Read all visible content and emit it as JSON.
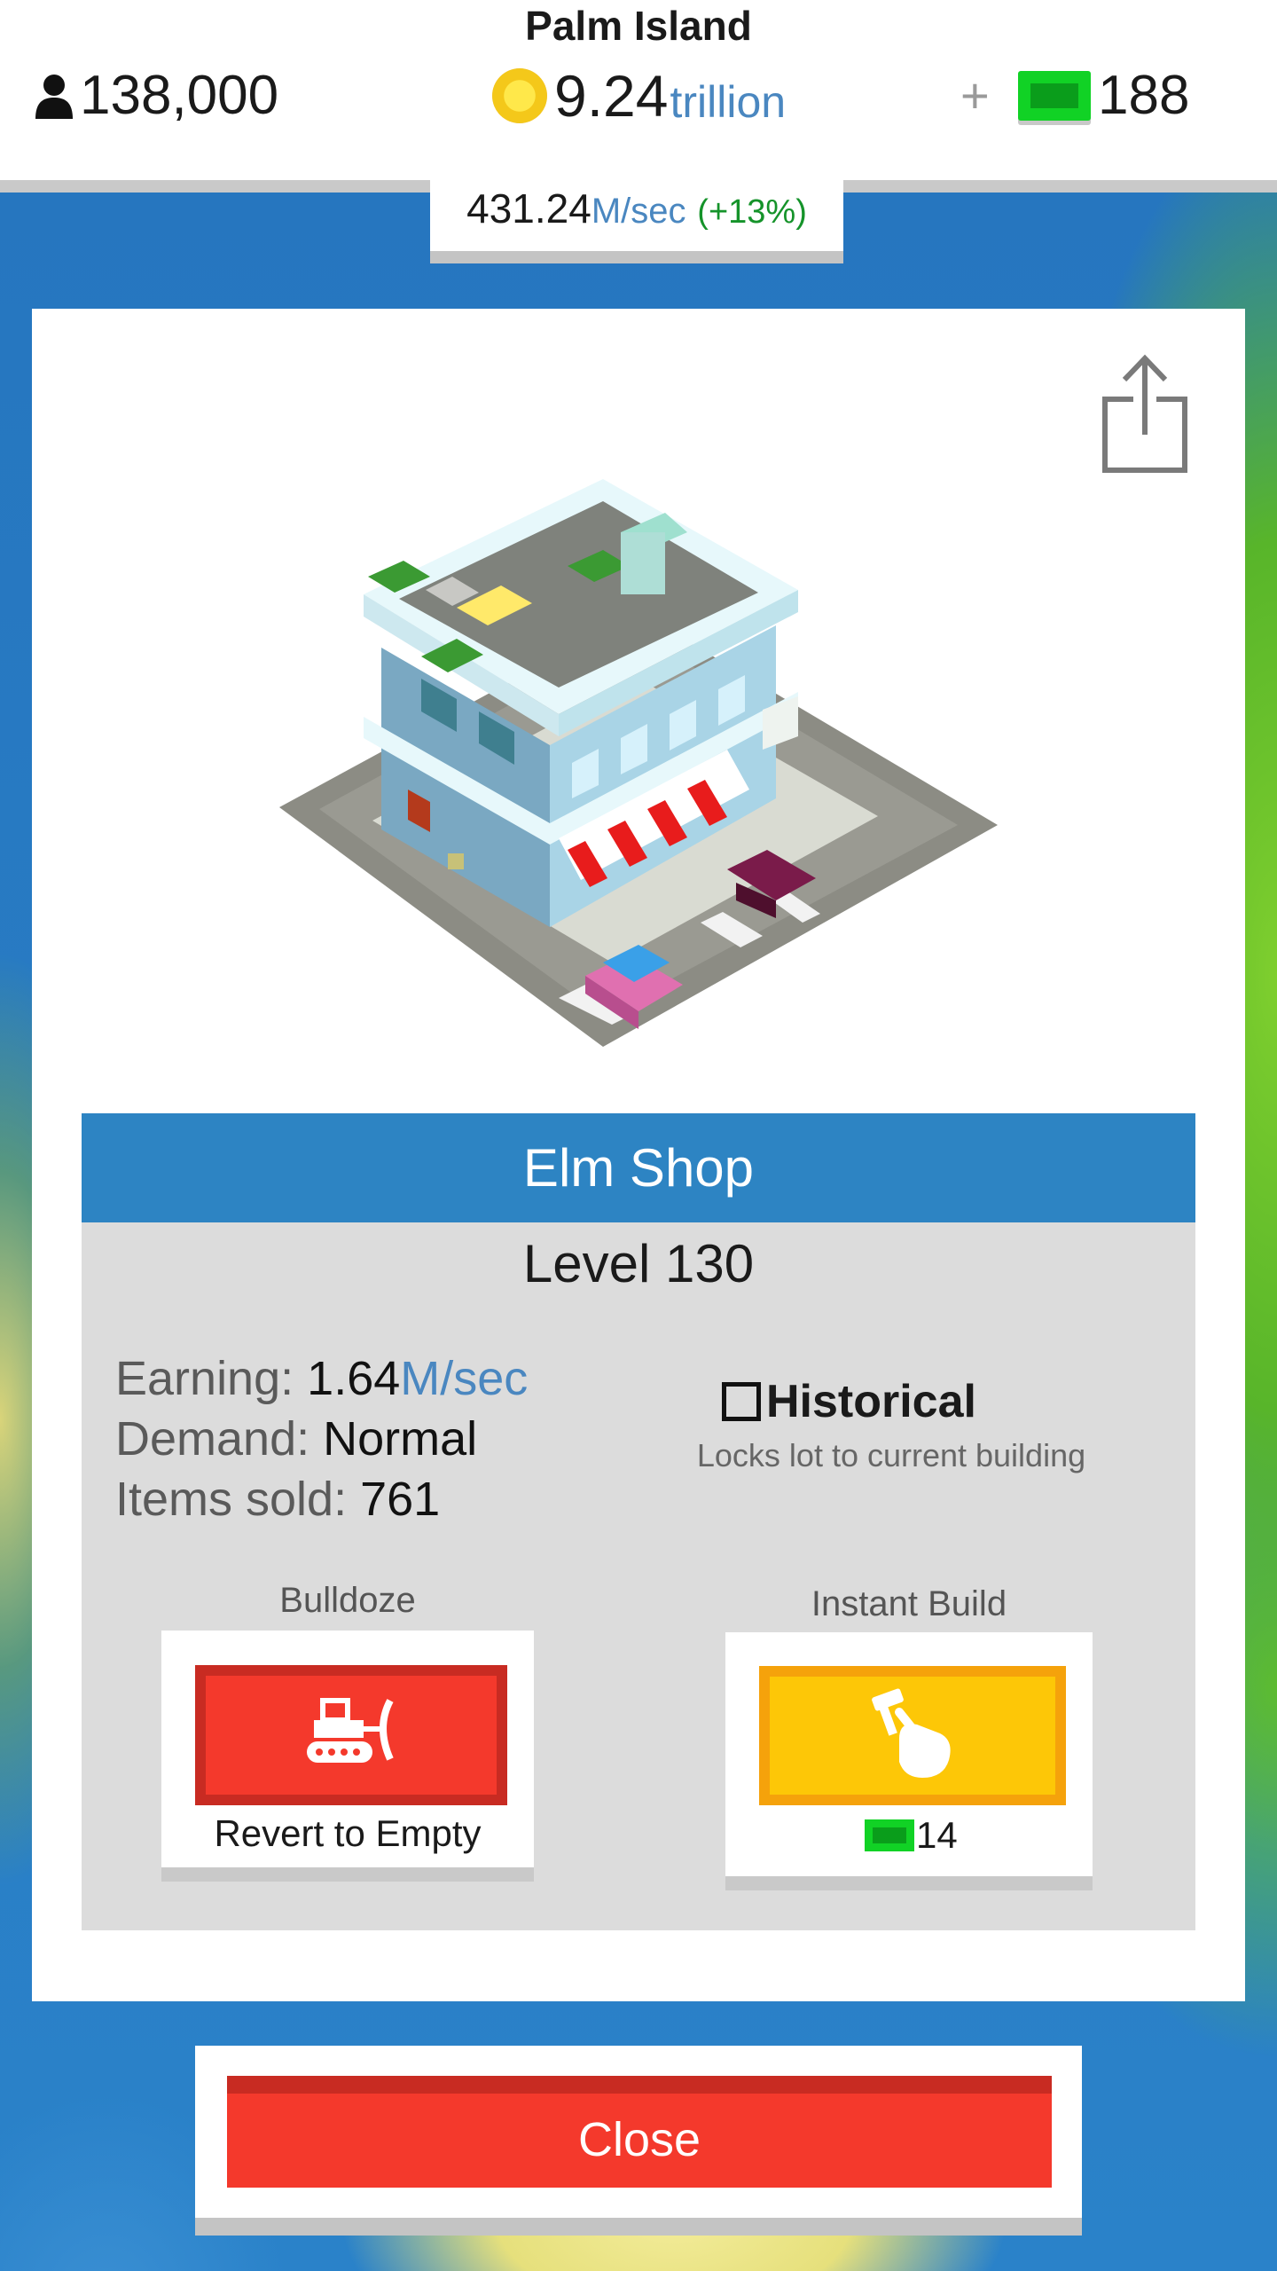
{
  "header": {
    "island_name": "Palm Island",
    "population": "138,000",
    "coins_value": "9.24",
    "coins_unit": "trillion",
    "plus": "+",
    "bucks": "188",
    "icons": [
      "person-icon",
      "coin-icon",
      "bill-icon"
    ]
  },
  "rate": {
    "value": "431.24",
    "unit": "M/sec",
    "bonus": "(+13%)"
  },
  "building": {
    "name": "Elm Shop",
    "level": "Level 130",
    "earning_label": "Earning:",
    "earning_value": "1.64",
    "earning_unit": "M/sec",
    "demand_label": "Demand:",
    "demand_value": "Normal",
    "items_label": "Items sold:",
    "items_value": "761"
  },
  "historical": {
    "label": "Historical",
    "checked": false,
    "description": "Locks lot to current building"
  },
  "bulldoze": {
    "title": "Bulldoze",
    "button_label": "Revert to Empty",
    "icon": "bulldozer-icon"
  },
  "instant_build": {
    "title": "Instant Build",
    "cost": "14",
    "icon": "hammer-hand-icon"
  },
  "close_label": "Close",
  "colors": {
    "header_blue": "#2d84c3",
    "bulldoze_red": "#f4392c",
    "instant_yellow": "#fdc707",
    "bucks_green": "#11d225",
    "accent_blue_text": "#4a87c0"
  }
}
